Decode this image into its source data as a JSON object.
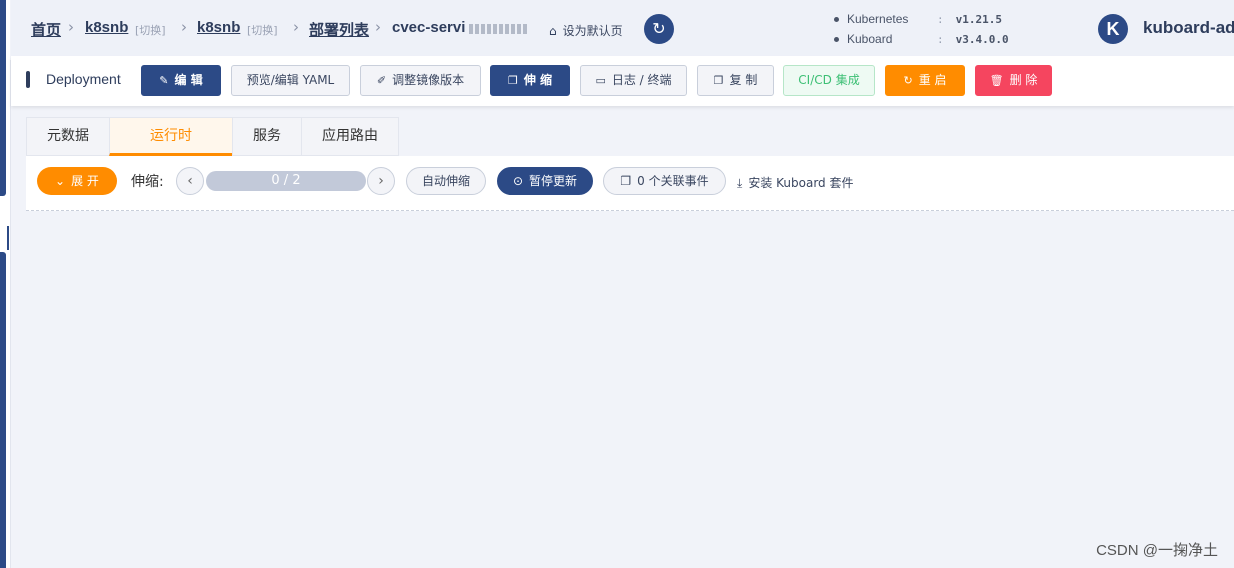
{
  "breadcrumb": {
    "home": "首页",
    "cluster": "k8snb",
    "cluster_switch": "[切换]",
    "namespace": "k8snb",
    "namespace_switch": "[切换]",
    "list": "部署列表",
    "current": "cvec-servi"
  },
  "header": {
    "set_default": "设为默认页",
    "kubernetes_label": "Kubernetes",
    "kubernetes_version": "v1.21.5",
    "kuboard_label": "Kuboard",
    "kuboard_version": "v3.4.0.0",
    "logo_letter": "K",
    "brand": "kuboard-ad",
    "version_colon": ":"
  },
  "toolbar": {
    "title": "Deployment",
    "buttons": {
      "edit": "编 辑",
      "yaml": "预览/编辑 YAML",
      "image": "调整镜像版本",
      "scale": "伸 缩",
      "logs": "日志 / 终端",
      "copy": "复 制",
      "cicd": "CI/CD 集成",
      "restart": "重 启",
      "delete": "删 除"
    }
  },
  "tabs": [
    "元数据",
    "运行时",
    "服务",
    "应用路由"
  ],
  "active_tab": "运行时",
  "runtime": {
    "expand": "展 开",
    "scale_label": "伸缩:",
    "replicas_text": "0 / 2",
    "replicas_fraction": 0,
    "auto_scale": "自动伸缩",
    "pause_update": "暂停更新",
    "events": "0 个关联事件",
    "install": "安装 Kuboard 套件"
  },
  "watermark": "CSDN @一掬净土",
  "colors": {
    "primary": "#2c4a86",
    "accent": "#ff8c00",
    "danger": "#f5455f",
    "success": "#3cbf74"
  }
}
